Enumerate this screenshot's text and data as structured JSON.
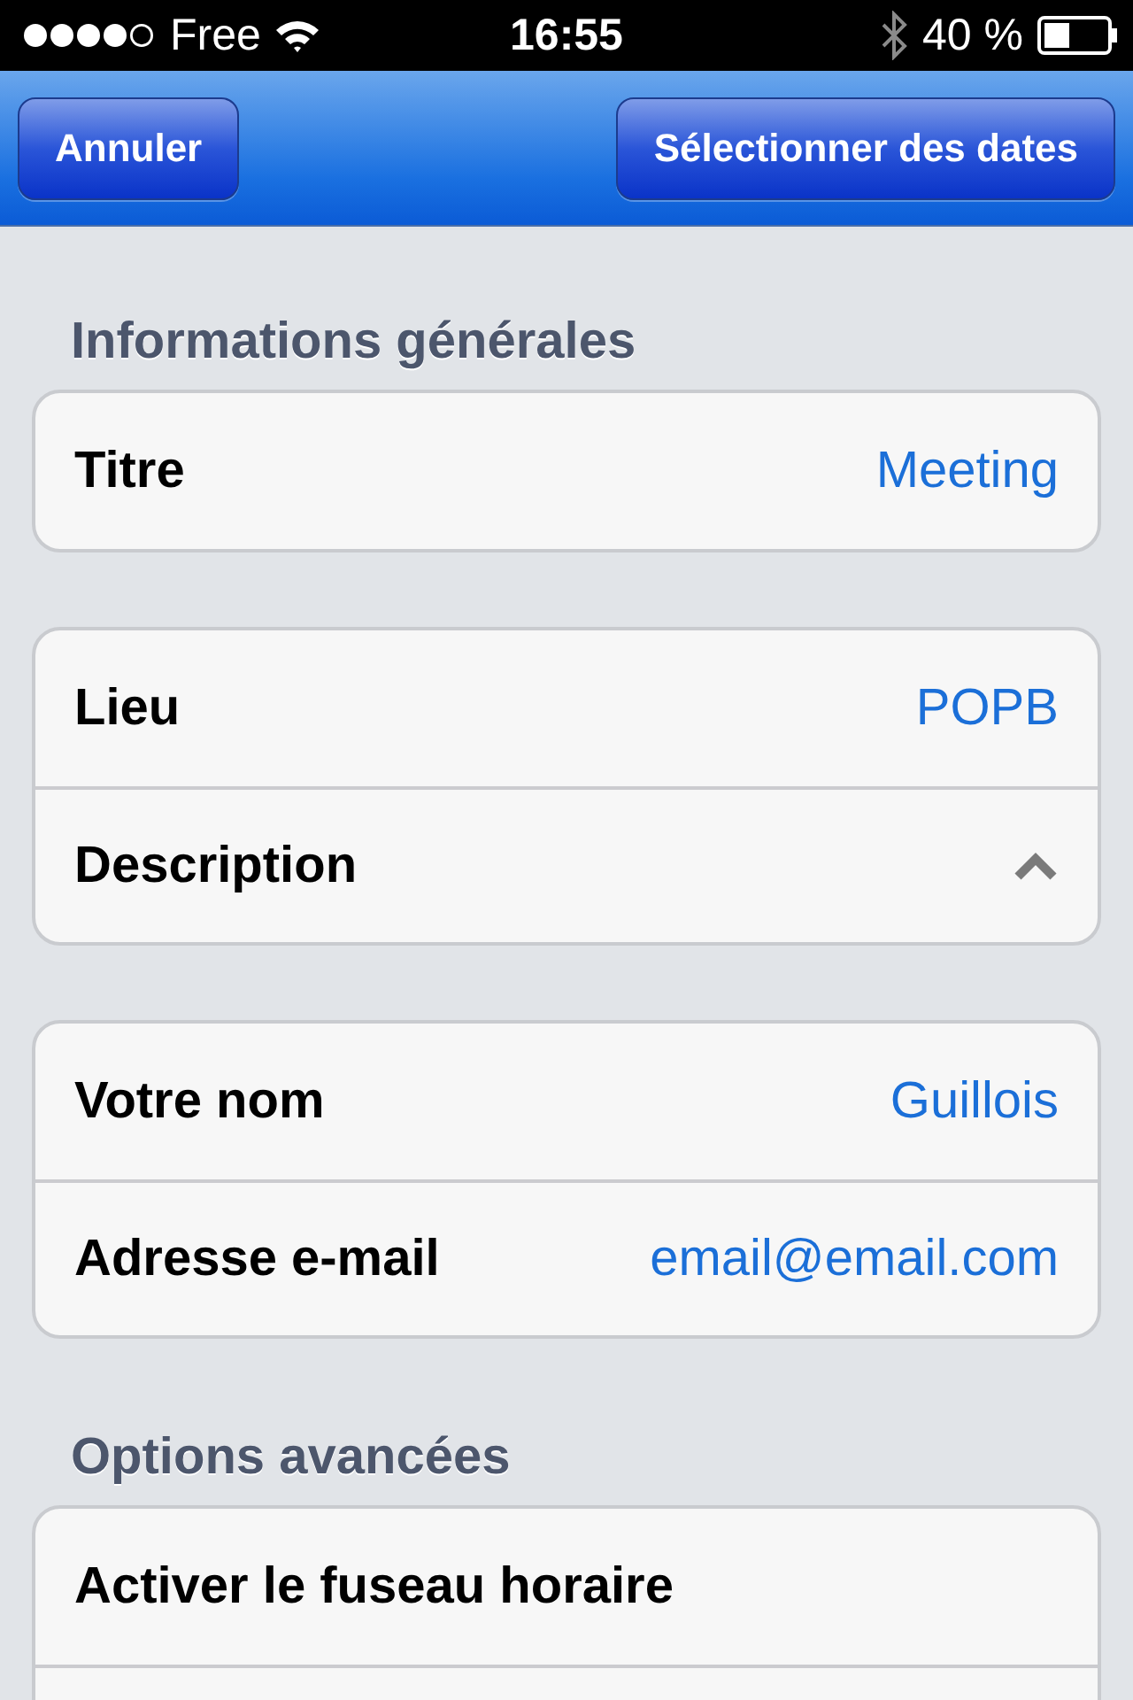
{
  "status_bar": {
    "carrier": "Free",
    "time": "16:55",
    "battery": "40 %"
  },
  "nav_bar": {
    "left_button": "Annuler",
    "right_button": "Sélectionner des dates"
  },
  "sections": [
    {
      "header": "Informations générales",
      "cards": [
        [
          {
            "kind": "value",
            "label": "Titre",
            "value": "Meeting"
          }
        ],
        [
          {
            "kind": "value",
            "label": "Lieu",
            "value": "POPB"
          },
          {
            "kind": "disclosure",
            "label": "Description",
            "expanded": true
          }
        ],
        [
          {
            "kind": "value",
            "label": "Votre nom",
            "value": "Guillois"
          },
          {
            "kind": "value",
            "label": "Adresse e-mail",
            "value": "email@email.com"
          }
        ]
      ]
    },
    {
      "header": "Options avancées",
      "cards": [
        [
          {
            "kind": "plain",
            "label": "Activer le fuseau horaire"
          },
          {
            "kind": "blank"
          }
        ]
      ]
    }
  ]
}
